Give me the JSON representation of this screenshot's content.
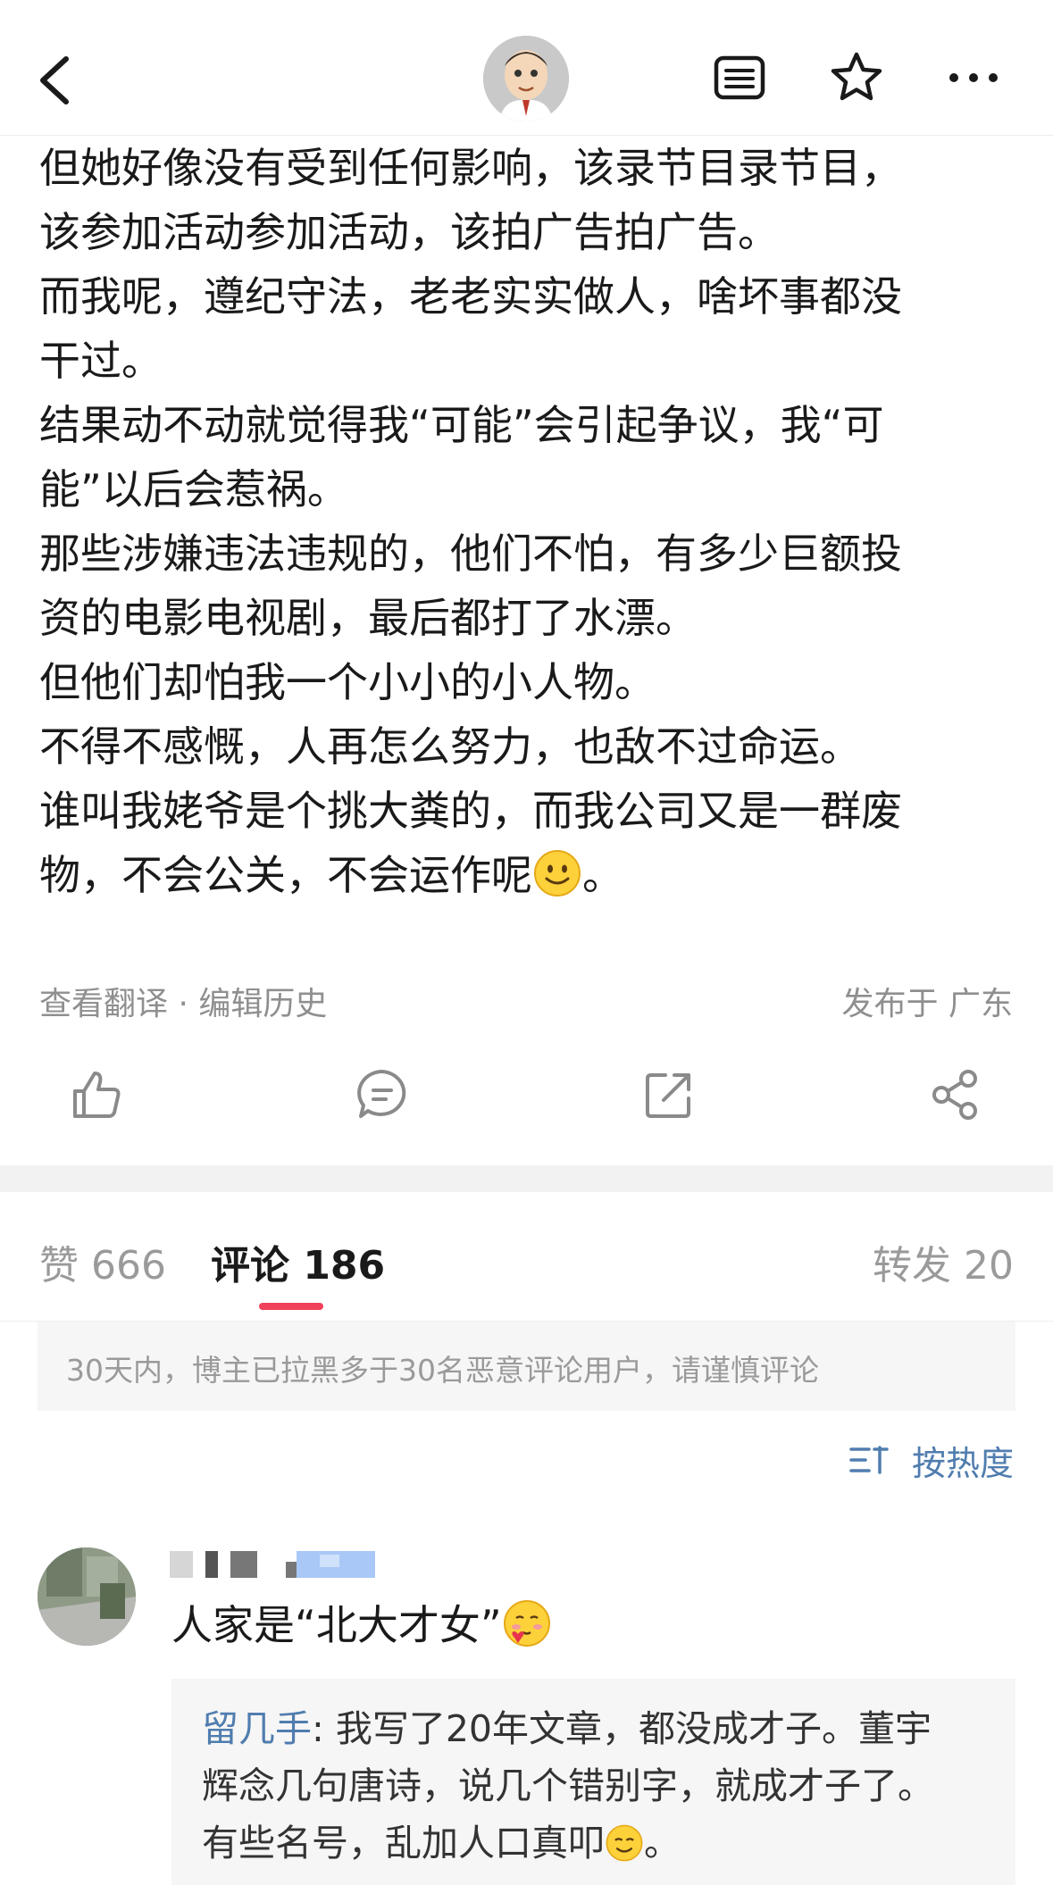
{
  "header": {
    "back_icon": "chevron-left-icon",
    "avatar_icon": "cartoon-avatar",
    "list_icon": "list-icon",
    "star_icon": "star-icon",
    "more_icon": "more-icon"
  },
  "article": {
    "lines": [
      "但她好像没有受到任何影响，该录节目录节目，",
      "该参加活动参加活动，该拍广告拍广告。",
      "而我呢，遵纪守法，老老实实做人，啥坏事都没",
      "干过。",
      "结果动不动就觉得我“可能”会引起争议，我“可",
      "能”以后会惹祸。",
      "那些涉嫌违法违规的，他们不怕，有多少巨额投",
      "资的电影电视剧，最后都打了水漂。",
      "但他们却怕我一个小小的小人物。",
      "",
      "不得不感慨，人再怎么努力，也敌不过命运。",
      "谁叫我姥爷是个挑大粪的，而我公司又是一群废",
      "物，不会公关，不会运作呢"
    ],
    "last_suffix": "。",
    "meta_left": "查看翻译 · 编辑历史",
    "meta_right": "发布于 广东"
  },
  "actions": {
    "like_icon": "thumbs-up-icon",
    "comment_icon": "comment-icon",
    "repost_icon": "repost-icon",
    "share_icon": "share-icon"
  },
  "tabs": {
    "likes": "赞 666",
    "comments": "评论 186",
    "reposts": "转发 20",
    "active_color": "#f1405a"
  },
  "notice": "30天内，博主已拉黑多于30名恶意评论用户，请谨慎评论",
  "sort": {
    "label": "按热度",
    "icon": "sort-icon",
    "color": "#507daf"
  },
  "comment": {
    "text": "人家是“北大才女”",
    "reply_name": "留几手",
    "reply_lines": [
      ": 我写了20年文章，都没成才子。董宇",
      "辉念几句唐诗，说几个错别字，就成才子了。",
      "有些名号，乱加人口真叩"
    ],
    "reply_suffix": "。"
  }
}
